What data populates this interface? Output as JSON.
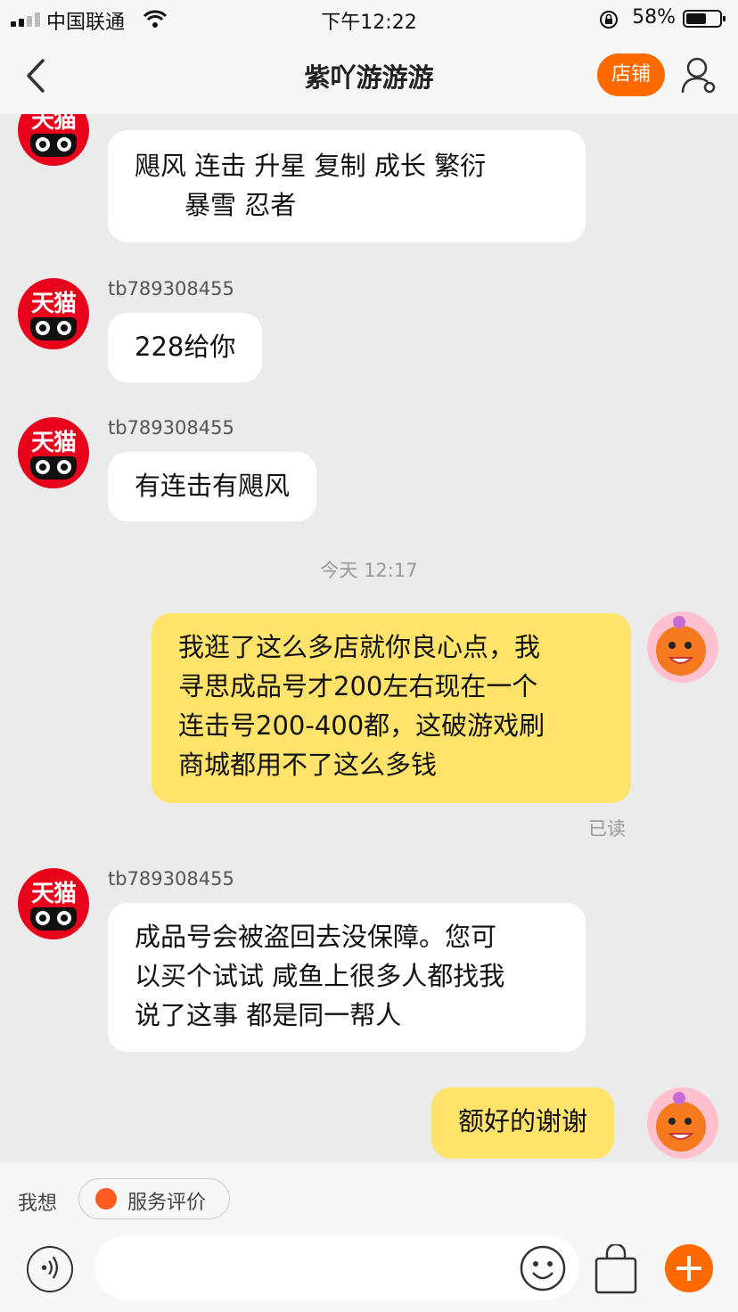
{
  "status_bar": {
    "carrier": "中国联通",
    "time": "下午12:22",
    "battery": "58%"
  },
  "nav": {
    "title": "紫吖游游游",
    "shop_button": "店铺"
  },
  "messages": [
    {
      "sender": "",
      "text_lines": [
        "飓风 连击   升星 复制 成长 繁衍",
        "    暴雪 忍者"
      ]
    },
    {
      "sender": "tb789308455",
      "text_lines": [
        "228给你"
      ]
    },
    {
      "sender": "tb789308455",
      "text_lines": [
        "有连击有飓风"
      ]
    },
    {
      "timestamp": "今天 12:17"
    },
    {
      "sender": "me",
      "text_lines": [
        "我逛了这么多店就你良心点，我",
        "寻思成品号才200左右现在一个",
        "连击号200-400都，这破游戏刷",
        "商城都用不了这么多钱"
      ],
      "status": "已读"
    },
    {
      "sender": "tb789308455",
      "text_lines": [
        "成品号会被盗回去没保障。您可",
        "以买个试试  咸鱼上很多人都找我",
        "说了这事  都是同一帮人"
      ]
    },
    {
      "sender": "me",
      "text_lines": [
        "额好的谢谢"
      ]
    }
  ],
  "bottom": {
    "want_label": "我想",
    "service_chip": "服务评价"
  },
  "icons": {
    "avatar_tmall_text": "天猫"
  },
  "colors": {
    "accent": "#ff6a00",
    "my_bubble": "#ffe36b",
    "tmall_red": "#e9001b"
  }
}
